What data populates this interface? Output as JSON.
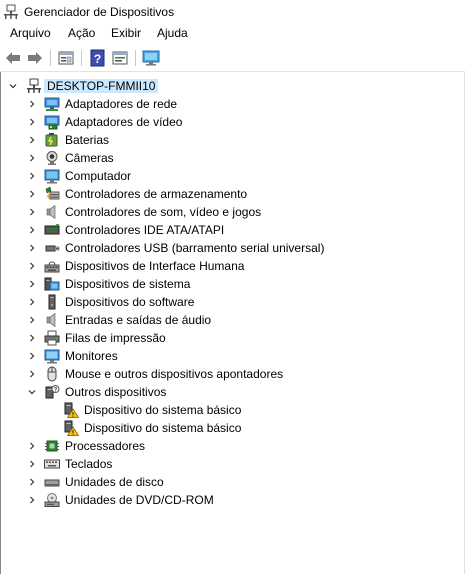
{
  "window": {
    "title": "Gerenciador de Dispositivos"
  },
  "menu": [
    "Arquivo",
    "Ação",
    "Exibir",
    "Ajuda"
  ],
  "toolbar": [
    {
      "name": "back-button",
      "icon": "arrow-left-icon"
    },
    {
      "name": "forward-button",
      "icon": "arrow-right-icon"
    },
    {
      "name": "properties-button",
      "icon": "properties-icon"
    },
    {
      "name": "help-button",
      "icon": "help-icon"
    },
    {
      "name": "driver-button",
      "icon": "driver-icon"
    },
    {
      "name": "scan-hardware-button",
      "icon": "monitor-scan-icon"
    }
  ],
  "tree": {
    "root": {
      "label": "DESKTOP-FMMII10",
      "icon": "computer-network-icon",
      "expanded": true,
      "selected": true
    },
    "items": [
      {
        "label": "Adaptadores de rede",
        "icon": "network-adapter-icon",
        "expanded": false,
        "children": []
      },
      {
        "label": "Adaptadores de vídeo",
        "icon": "display-adapter-icon",
        "expanded": false,
        "children": []
      },
      {
        "label": "Baterias",
        "icon": "battery-icon",
        "expanded": false,
        "children": []
      },
      {
        "label": "Câmeras",
        "icon": "camera-icon",
        "expanded": false,
        "children": []
      },
      {
        "label": "Computador",
        "icon": "computer-icon",
        "expanded": false,
        "children": []
      },
      {
        "label": "Controladores de armazenamento",
        "icon": "storage-controller-icon",
        "expanded": false,
        "children": []
      },
      {
        "label": "Controladores de som, vídeo e jogos",
        "icon": "speaker-icon",
        "expanded": false,
        "children": []
      },
      {
        "label": "Controladores IDE ATA/ATAPI",
        "icon": "ide-controller-icon",
        "expanded": false,
        "children": []
      },
      {
        "label": "Controladores USB (barramento serial universal)",
        "icon": "usb-icon",
        "expanded": false,
        "children": []
      },
      {
        "label": "Dispositivos de Interface Humana",
        "icon": "hid-icon",
        "expanded": false,
        "children": []
      },
      {
        "label": "Dispositivos de sistema",
        "icon": "system-device-icon",
        "expanded": false,
        "children": []
      },
      {
        "label": "Dispositivos do software",
        "icon": "software-device-icon",
        "expanded": false,
        "children": []
      },
      {
        "label": "Entradas e saídas de áudio",
        "icon": "audio-io-icon",
        "expanded": false,
        "children": []
      },
      {
        "label": "Filas de impressão",
        "icon": "printer-icon",
        "expanded": false,
        "children": []
      },
      {
        "label": "Monitores",
        "icon": "monitor-icon",
        "expanded": false,
        "children": []
      },
      {
        "label": "Mouse e outros dispositivos apontadores",
        "icon": "mouse-icon",
        "expanded": false,
        "children": []
      },
      {
        "label": "Outros dispositivos",
        "icon": "unknown-device-icon",
        "expanded": true,
        "children": [
          {
            "label": "Dispositivo do sistema básico",
            "icon": "warning-device-icon"
          },
          {
            "label": "Dispositivo do sistema básico",
            "icon": "warning-device-icon"
          }
        ]
      },
      {
        "label": "Processadores",
        "icon": "processor-icon",
        "expanded": false,
        "children": []
      },
      {
        "label": "Teclados",
        "icon": "keyboard-icon",
        "expanded": false,
        "children": []
      },
      {
        "label": "Unidades de disco",
        "icon": "disk-drive-icon",
        "expanded": false,
        "children": []
      },
      {
        "label": "Unidades de DVD/CD-ROM",
        "icon": "dvd-drive-icon",
        "expanded": false,
        "children": []
      }
    ]
  }
}
